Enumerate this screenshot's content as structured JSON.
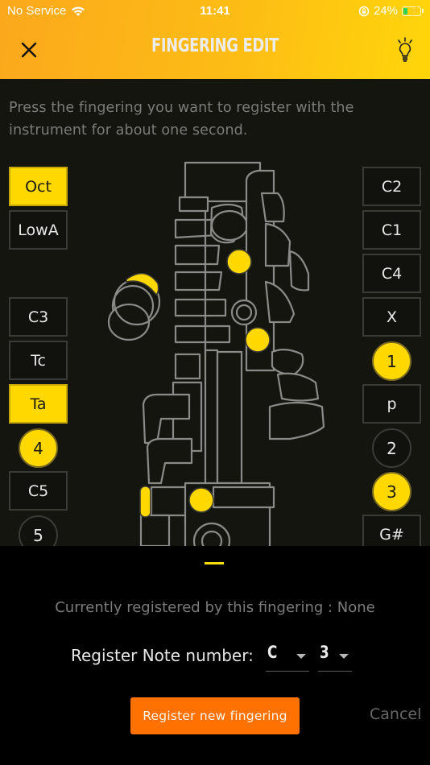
{
  "status_bar": {
    "carrier": "No Service",
    "time": "11:41",
    "battery_percent": "24%",
    "wifi_icon": "wifi-icon",
    "orientation_lock_icon": "orientation-lock-icon",
    "battery_icon": "battery-charging-icon"
  },
  "header": {
    "title": "FINGERING EDIT",
    "close_icon": "close-icon",
    "hint_icon": "lightbulb-icon",
    "gradient_colors": [
      "#fba81c",
      "#ffd60a"
    ]
  },
  "instruction": "Press the fingering you want to register with the instrument for about one second.",
  "left_keys": [
    {
      "label": "Oct",
      "shape": "box",
      "active": true
    },
    {
      "label": "LowA",
      "shape": "box",
      "active": false
    },
    {
      "label": "C3",
      "shape": "box",
      "active": false
    },
    {
      "label": "Tc",
      "shape": "box",
      "active": false
    },
    {
      "label": "Ta",
      "shape": "box",
      "active": true
    },
    {
      "label": "4",
      "shape": "circle",
      "active": true
    },
    {
      "label": "C5",
      "shape": "box",
      "active": false
    },
    {
      "label": "5",
      "shape": "circle",
      "active": false
    }
  ],
  "right_keys": [
    {
      "label": "C2",
      "shape": "box",
      "active": false
    },
    {
      "label": "C1",
      "shape": "box",
      "active": false
    },
    {
      "label": "C4",
      "shape": "box",
      "active": false
    },
    {
      "label": "X",
      "shape": "box",
      "active": false
    },
    {
      "label": "1",
      "shape": "circle",
      "active": true
    },
    {
      "label": "p",
      "shape": "box",
      "active": false
    },
    {
      "label": "2",
      "shape": "circle",
      "active": false
    },
    {
      "label": "3",
      "shape": "circle",
      "active": true
    },
    {
      "label": "G#",
      "shape": "box",
      "active": false
    }
  ],
  "colors": {
    "active": "#ffd800",
    "orange_button": "#ff7100",
    "background": "#151510",
    "sheet": "#000000",
    "outline": "#8a8a88"
  },
  "sheet": {
    "current_registration": "Currently registered by this fingering : None",
    "note_label": "Register Note number:",
    "note_value": "C",
    "octave_value": "3",
    "register_button": "Register new fingering",
    "cancel_button": "Cancel"
  }
}
